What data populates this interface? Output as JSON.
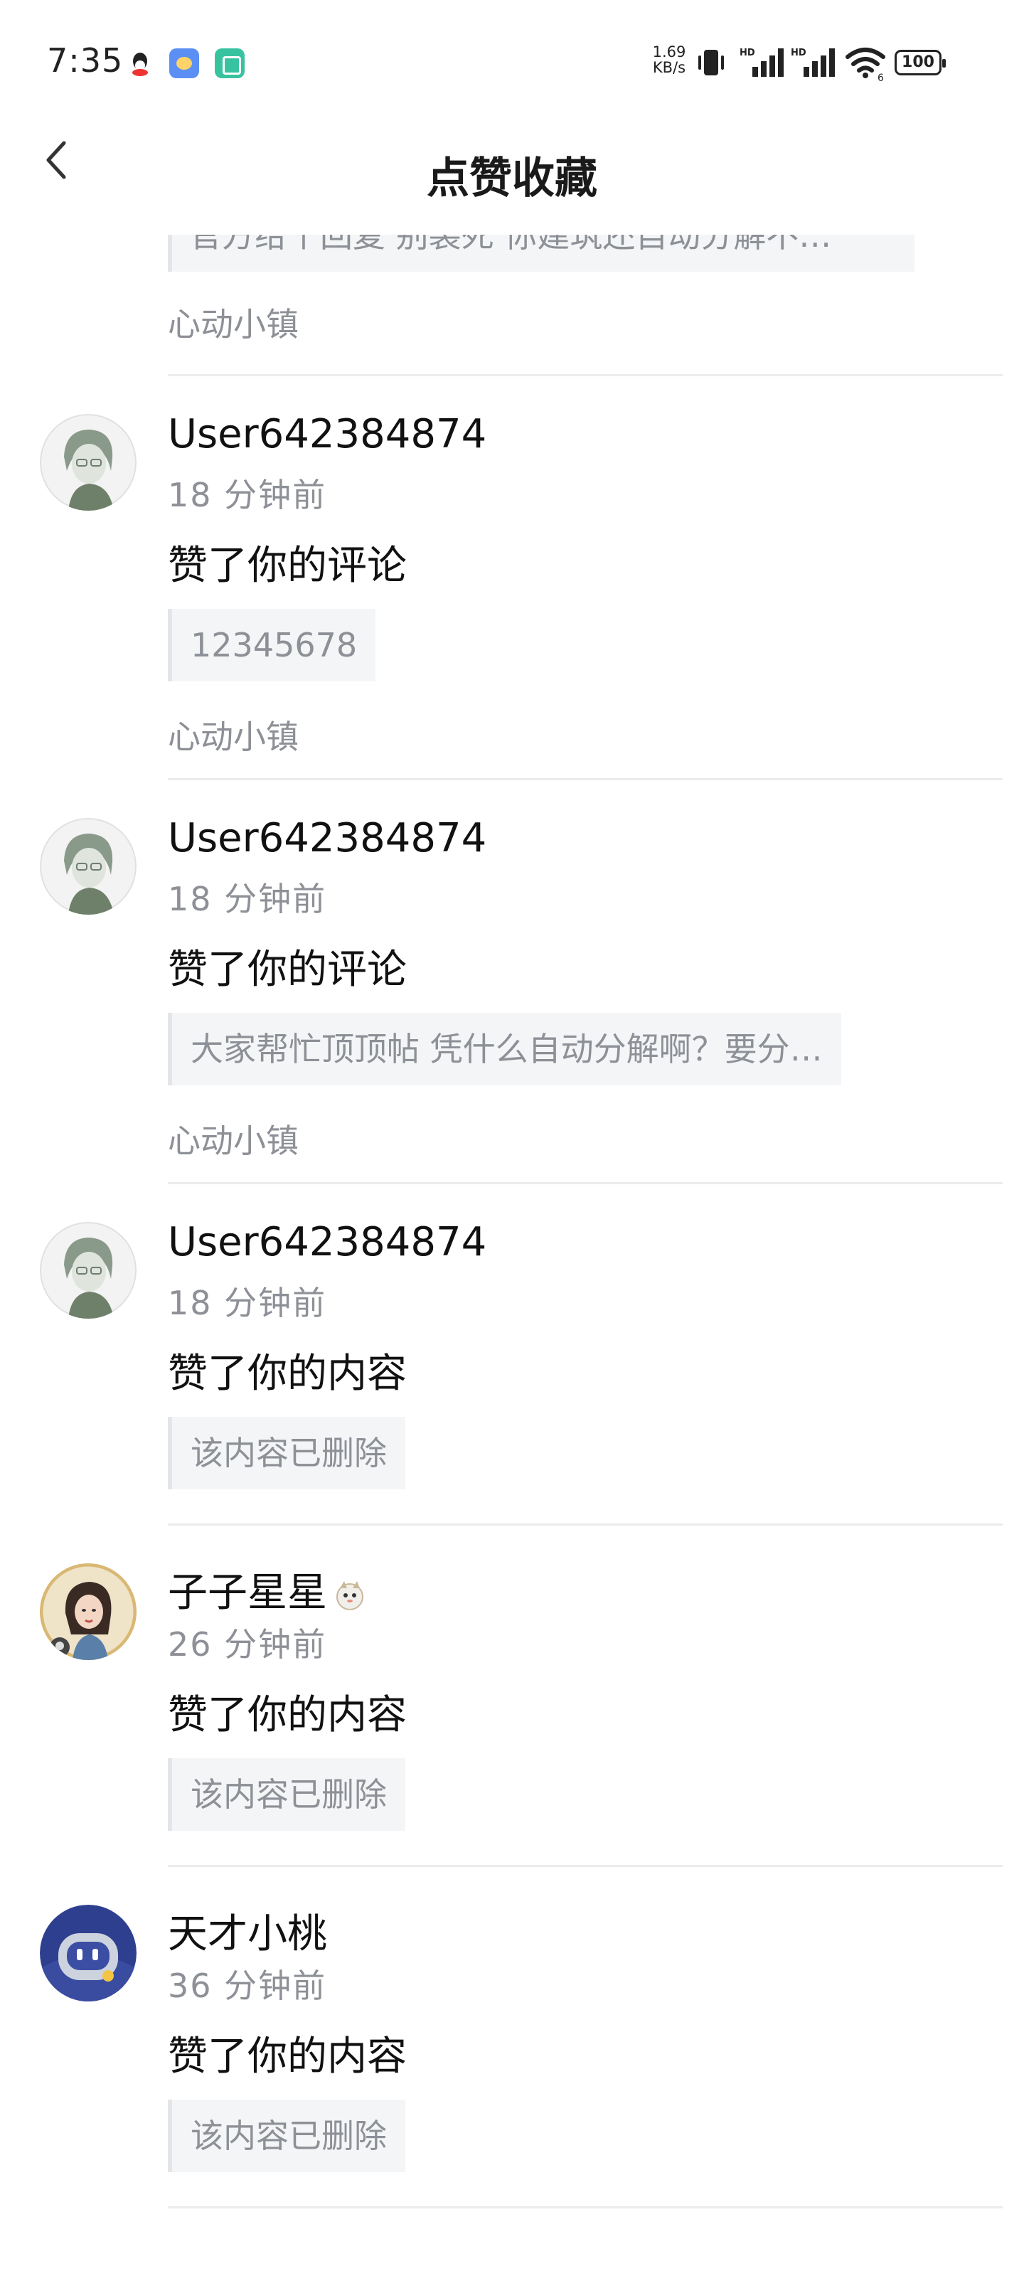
{
  "status_bar": {
    "time": "7:35",
    "net_speed_value": "1.69",
    "net_speed_unit": "KB/s",
    "battery": "100",
    "icons": [
      "qq-icon",
      "app-icon",
      "app-icon",
      "vibrate-icon",
      "hd-signal-icon",
      "hd-signal-icon",
      "wifi-icon",
      "battery-icon"
    ]
  },
  "header": {
    "title": "点赞收藏",
    "back_icon": "chevron-left-icon"
  },
  "partial_item": {
    "quote": "官方给个回复 别装死 你建筑还自动分解不…",
    "community": "心动小镇"
  },
  "items": [
    {
      "username": "User642384874",
      "time": "18 分钟前",
      "action": "赞了你的评论",
      "quote": "12345678",
      "community": "心动小镇",
      "avatar": "anime-boy-avatar"
    },
    {
      "username": "User642384874",
      "time": "18 分钟前",
      "action": "赞了你的评论",
      "quote": "大家帮忙顶顶帖 凭什么自动分解啊？要分…",
      "community": "心动小镇",
      "avatar": "anime-boy-avatar"
    },
    {
      "username": "User642384874",
      "time": "18 分钟前",
      "action": "赞了你的内容",
      "quote": "该内容已删除",
      "avatar": "anime-boy-avatar"
    },
    {
      "username": "子子星星",
      "time": "26 分钟前",
      "action": "赞了你的内容",
      "quote": "该内容已删除",
      "avatar": "girl-portrait-avatar",
      "badge": "pet-badge-icon"
    },
    {
      "username": "天才小桃",
      "time": "36 分钟前",
      "action": "赞了你的内容",
      "quote": "该内容已删除",
      "avatar": "robot-avatar"
    }
  ]
}
